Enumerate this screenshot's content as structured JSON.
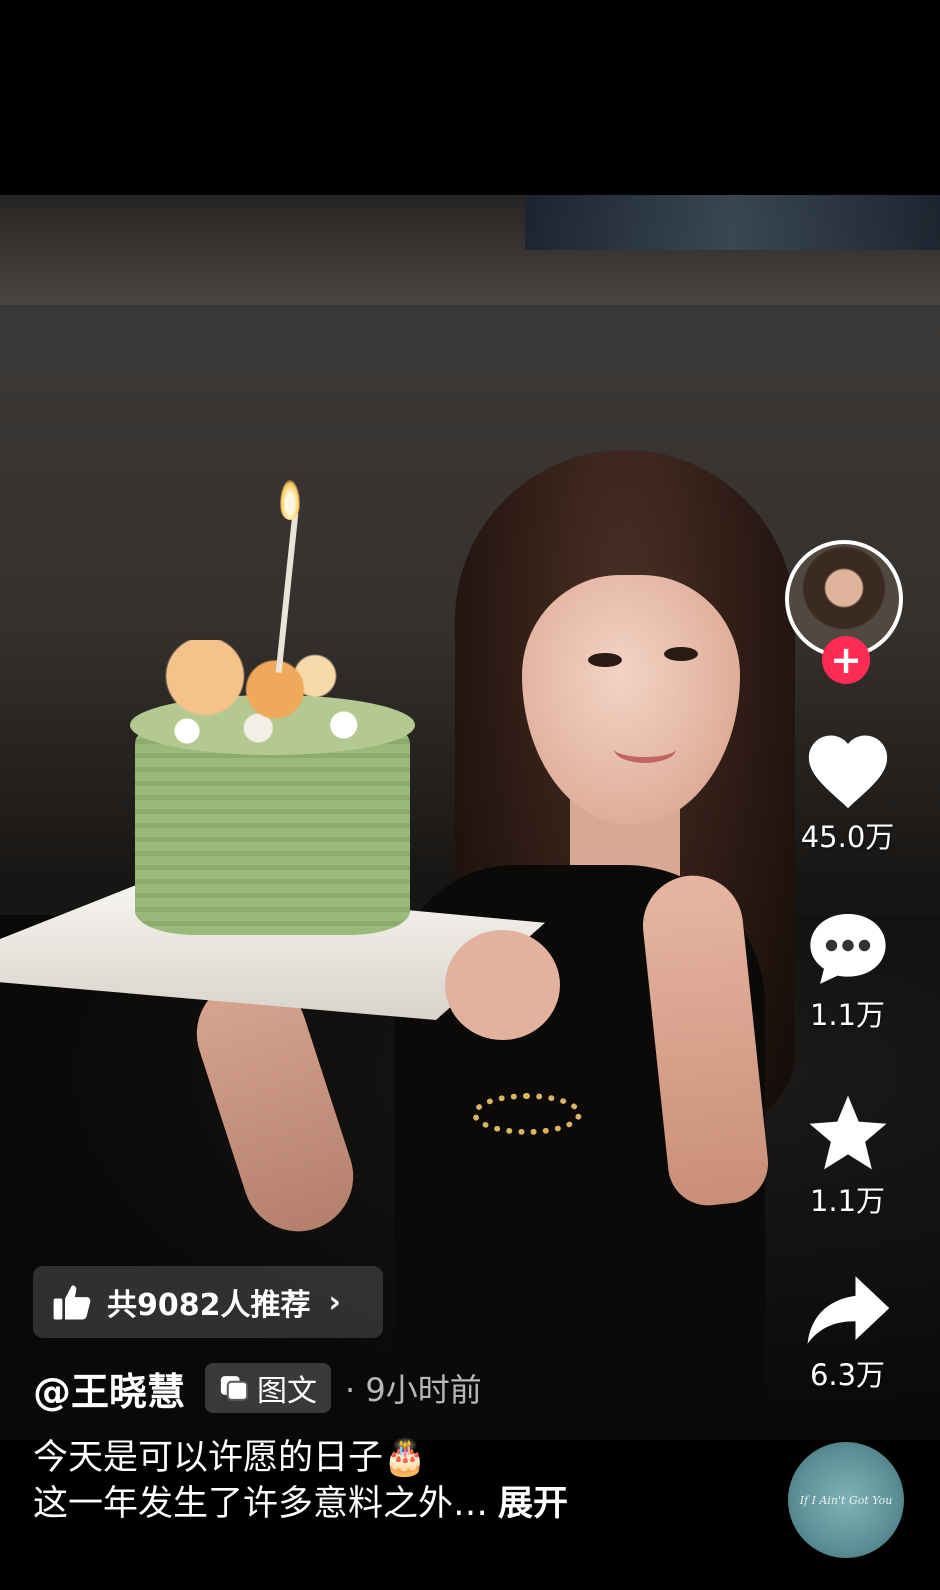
{
  "post": {
    "recommend_label": "共9082人推荐",
    "recommend_chevron": "›",
    "author": "@王晓慧",
    "type_tag": "图文",
    "time": "· 9小时前",
    "caption_line1": "今天是可以许愿的日子🎂",
    "caption_line2": "这一年发生了许多意料之外…",
    "expand_label": "展开"
  },
  "actions": {
    "follow": "+",
    "likes": "45.0万",
    "comments": "1.1万",
    "favorites": "1.1万",
    "shares": "6.3万"
  },
  "music": {
    "disc_text": "If I Ain't Got You"
  },
  "icons": {
    "like": "heart-icon",
    "comment": "comment-bubble-icon",
    "favorite": "star-icon",
    "share": "share-arrow-icon",
    "recommend": "thumbs-up-icon",
    "type": "image-text-icon"
  },
  "colors": {
    "follow_button": "#fe2c55",
    "icon_fill": "#ffffff"
  }
}
